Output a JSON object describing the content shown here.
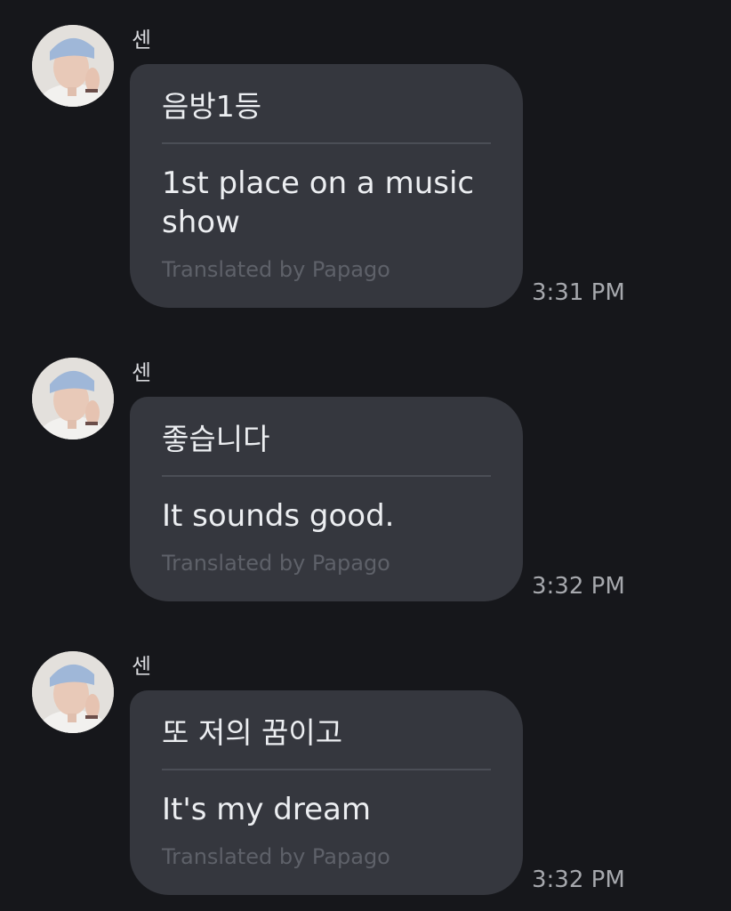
{
  "messages": [
    {
      "sender": "센",
      "original": "음방1등",
      "translation": "1st place on a music show",
      "credit": "Translated by Papago",
      "time": "3:31 PM"
    },
    {
      "sender": "센",
      "original": "좋습니다",
      "translation": "It sounds good.",
      "credit": "Translated by Papago",
      "time": "3:32 PM"
    },
    {
      "sender": "센",
      "original": "또 저의 꿈이고",
      "translation": "It's my dream",
      "credit": "Translated by Papago",
      "time": "3:32 PM"
    }
  ],
  "colors": {
    "background": "#16171b",
    "bubble": "#35373e",
    "text": "#eceef1",
    "muted": "#5e6169",
    "time": "#a6a8ad"
  },
  "icons": {
    "avatar": "user-avatar-photo"
  }
}
